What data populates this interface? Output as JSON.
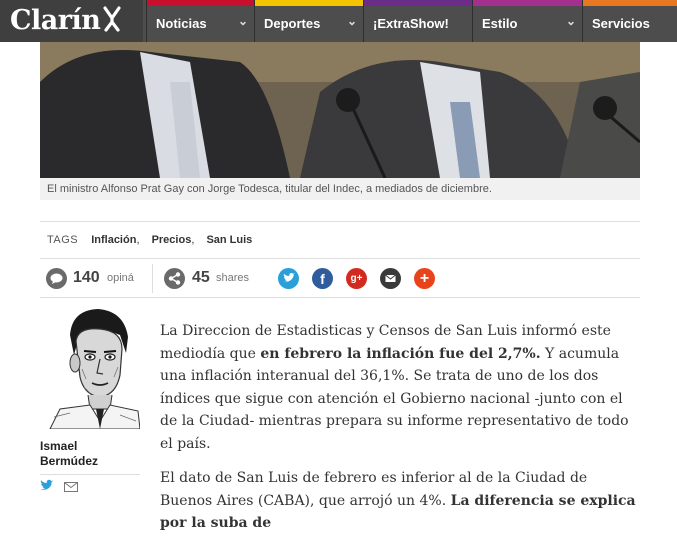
{
  "header": {
    "logo": "Clarín",
    "nav": [
      {
        "label": "Noticias",
        "color": "#c8102e",
        "dropdown": true
      },
      {
        "label": "Deportes",
        "color": "#f2c500",
        "dropdown": true
      },
      {
        "label": "¡ExtraShow!",
        "color": "#6b2d87",
        "dropdown": false
      },
      {
        "label": "Estilo",
        "color": "#a42f8e",
        "dropdown": true
      },
      {
        "label": "Servicios",
        "color": "#e87722",
        "dropdown": false
      }
    ]
  },
  "photo": {
    "caption": "El ministro Alfonso Prat Gay con Jorge Todesca, titular del Indec, a mediados de diciembre."
  },
  "tags": {
    "label": "TAGS",
    "items": [
      "Inflación",
      "Precios",
      "San Luis"
    ]
  },
  "social": {
    "comments_count": "140",
    "comments_label": "opiná",
    "shares_count": "45",
    "shares_label": "shares",
    "buttons": [
      {
        "icon": "twitter-icon",
        "color": "#2a9fd8"
      },
      {
        "icon": "facebook-icon",
        "color": "#2f5c9c"
      },
      {
        "icon": "google-plus-icon",
        "color": "#d12b1f"
      },
      {
        "icon": "email-icon",
        "color": "#3a3a3a"
      },
      {
        "icon": "plus-icon",
        "color": "#e8441c"
      }
    ]
  },
  "author": {
    "first_name": "Ismael",
    "last_name": "Bermúdez"
  },
  "article": {
    "p1_a": "La Direccion de Estadisticas y Censos de San Luis informó este mediodía que ",
    "p1_bold": "en febrero la inflación fue del 2,7%.",
    "p1_b": " Y acumula una inflación interanual del 36,1%. Se trata de uno de los dos índices que sigue con atención el Gobierno nacional -junto con el de la Ciudad- mientras prepara su informe representativo de todo el país.",
    "p2_a": "El dato de San Luis de febrero es inferior al de la Ciudad de Buenos Aires (CABA), que arrojó un 4%. ",
    "p2_bold": "La diferencia se explica por la suba de"
  }
}
